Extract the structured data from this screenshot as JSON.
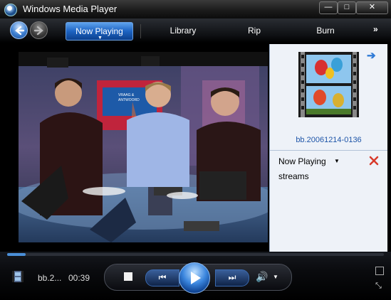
{
  "window": {
    "title": "Windows Media Player",
    "minimize_label": "—",
    "maximize_label": "□",
    "close_label": "✕"
  },
  "nav": {
    "tabs": [
      {
        "label": "Now Playing",
        "active": true
      },
      {
        "label": "Library",
        "active": false
      },
      {
        "label": "Rip",
        "active": false
      },
      {
        "label": "Burn",
        "active": false
      }
    ],
    "more_label": "»",
    "active_caret": "▼"
  },
  "panel": {
    "media_title": "bb.20061214-0136",
    "list_label": "Now Playing",
    "list_caret": "▼",
    "items": [
      "streams"
    ]
  },
  "controls": {
    "now_playing_short": "bb.2...",
    "time": "00:39",
    "prev_label": "⏮",
    "next_label": "⏭",
    "volume_icon": "🔊",
    "volume_caret": "▼",
    "seek_progress": 0.05
  },
  "colors": {
    "accent": "#2f7bd6",
    "link": "#1e55a8",
    "panel_bg": "#eef2f8"
  },
  "icons": [
    "app-icon",
    "back-arrow-icon",
    "forward-arrow-icon",
    "pane-arrow-icon",
    "delete-x-icon",
    "film-icon",
    "stop-icon",
    "previous-icon",
    "play-icon",
    "next-icon",
    "volume-icon",
    "switch-to-compact-icon",
    "fullscreen-icon"
  ]
}
